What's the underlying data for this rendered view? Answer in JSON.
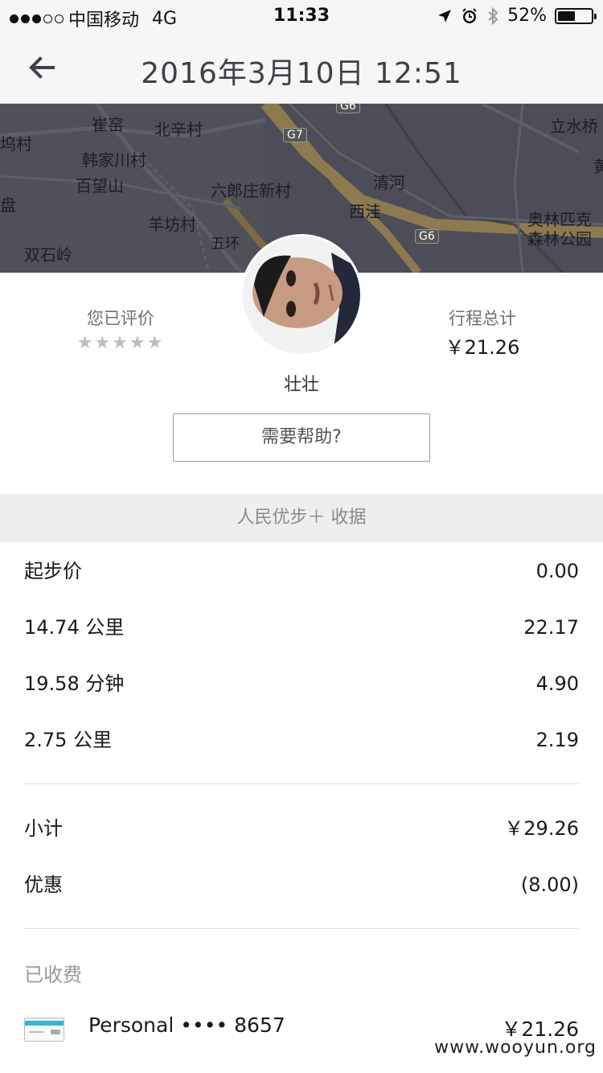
{
  "status_bar": {
    "carrier": "中国移动",
    "network": "4G",
    "time": "11:33",
    "battery_text": "52%",
    "battery_level": 0.52,
    "signal_filled": 3,
    "signal_total": 5
  },
  "nav": {
    "title": "2016年3月10日 12:51"
  },
  "map": {
    "labels": [
      "坞村",
      "崔窑",
      "北辛村",
      "韩家川村",
      "百望山",
      "六郎庄新村",
      "清河",
      "西洼",
      "羊坊村",
      "双石岭",
      "盘",
      "立水桥",
      "奥林匹克",
      "森林公园",
      "五环",
      "黄"
    ],
    "road_tags": [
      "G7",
      "G6",
      "G6"
    ]
  },
  "driver": {
    "rating_label": "您已评价",
    "stars": "★★★★★",
    "trip_total_label": "行程总计",
    "trip_total_value": "￥21.26",
    "name": "壮壮",
    "help_button": "需要帮助?"
  },
  "receipt": {
    "header": "人民优步＋ 收据",
    "items": [
      {
        "label": "起步价",
        "value": "0.00"
      },
      {
        "label": "14.74 公里",
        "value": "22.17"
      },
      {
        "label": "19.58 分钟",
        "value": "4.90"
      },
      {
        "label": "2.75 公里",
        "value": "2.19"
      }
    ],
    "subtotal_label": "小计",
    "subtotal_value": "￥29.26",
    "discount_label": "优惠",
    "discount_value": "(8.00)",
    "charged_label": "已收费",
    "payment_method": "Personal •••• 8657",
    "payment_amount": "￥21.26"
  },
  "watermark": "www.wooyun.org",
  "colors": {
    "map_bg": "#4a4b57",
    "card_stripe": "#35b6d2",
    "star_gray": "#bdbdbd"
  }
}
